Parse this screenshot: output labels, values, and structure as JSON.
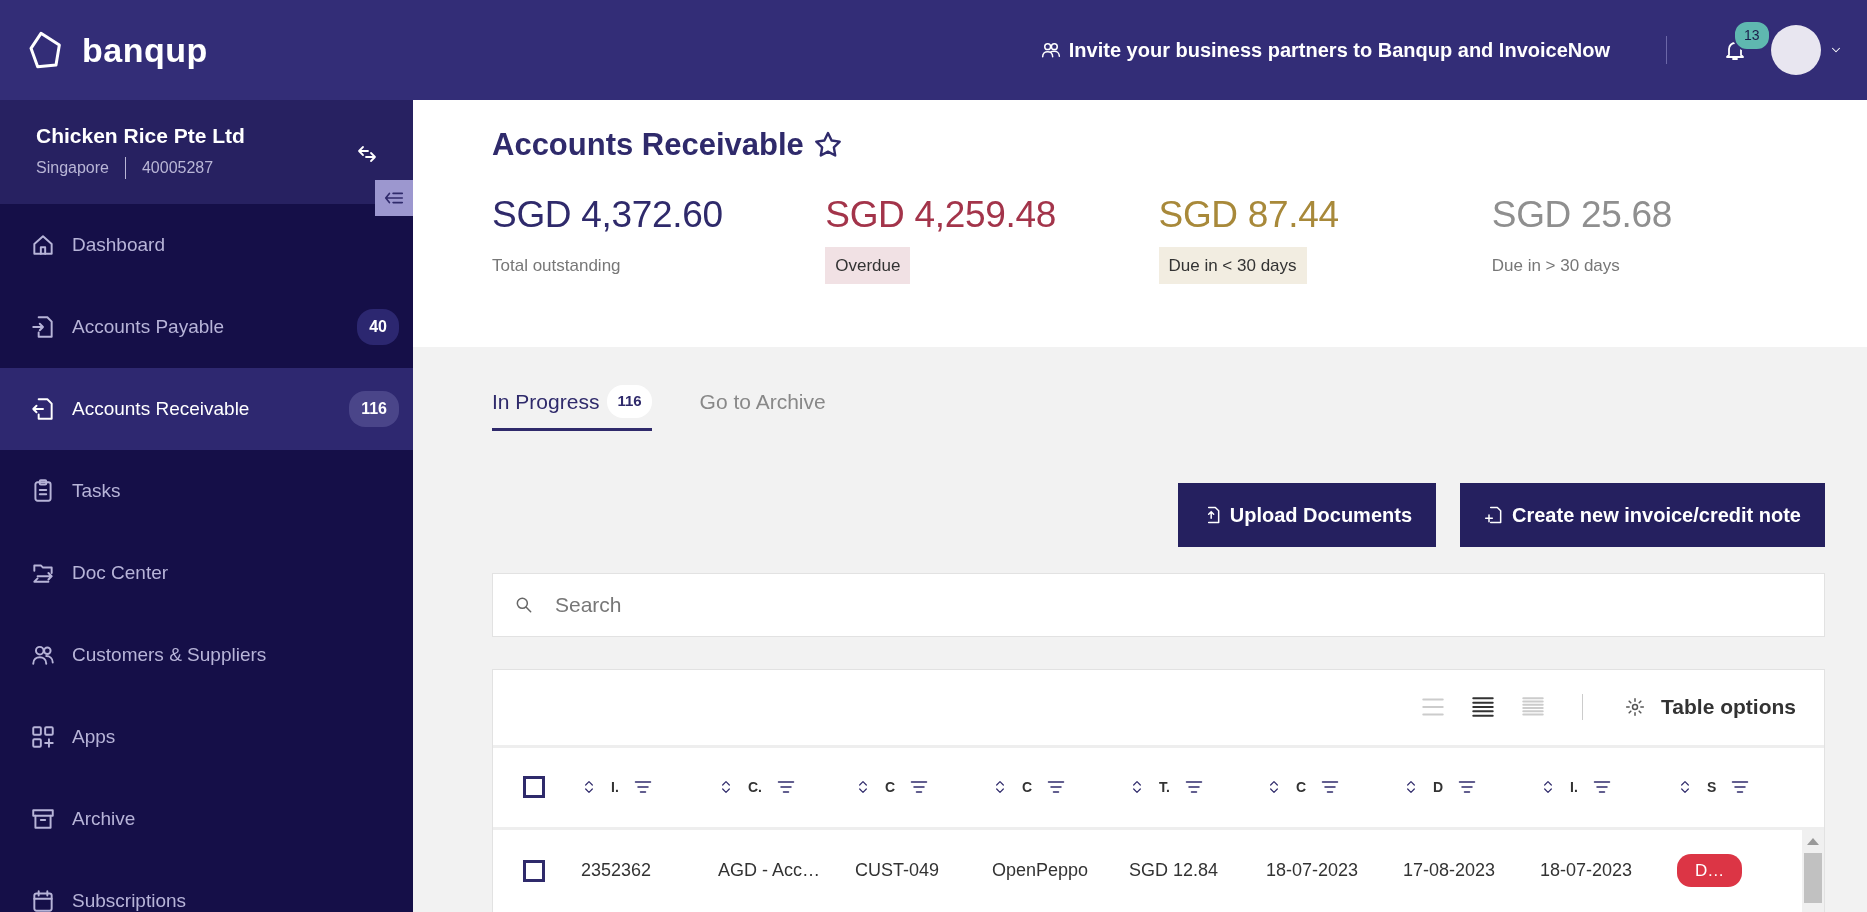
{
  "header": {
    "logo": "banqup",
    "invite": "Invite your business partners to Banqup and InvoiceNow",
    "notifications": "13"
  },
  "company": {
    "name": "Chicken Rice Pte Ltd",
    "country": "Singapore",
    "number": "40005287"
  },
  "sidebar": {
    "items": [
      {
        "label": "Dashboard",
        "selected": false
      },
      {
        "label": "Accounts Payable",
        "selected": false,
        "count": "40"
      },
      {
        "label": "Accounts Receivable",
        "selected": true,
        "count": "116"
      },
      {
        "label": "Tasks",
        "selected": false
      },
      {
        "label": "Doc Center",
        "selected": false
      },
      {
        "label": "Customers & Suppliers",
        "selected": false
      },
      {
        "label": "Apps",
        "selected": false
      },
      {
        "label": "Archive",
        "selected": false
      },
      {
        "label": "Subscriptions",
        "selected": false
      }
    ]
  },
  "page": {
    "title": "Accounts Receivable",
    "favorite": false
  },
  "stats": [
    {
      "amount": "SGD 4,372.60",
      "label": "Total outstanding",
      "color": "#2f2a6b",
      "kind": "plain"
    },
    {
      "amount": "SGD 4,259.48",
      "label": "Overdue",
      "color": "#a3344a",
      "kind": "tag"
    },
    {
      "amount": "SGD 87.44",
      "label": "Due in < 30 days",
      "color": "#a8893a",
      "kind": "tag"
    },
    {
      "amount": "SGD 25.68",
      "label": "Due in > 30 days",
      "color": "#8f8f8f",
      "kind": "plain"
    }
  ],
  "tabs": [
    {
      "label": "In Progress",
      "count": "116",
      "selected": true
    },
    {
      "label": "Go to Archive",
      "selected": false
    }
  ],
  "buttons": [
    "Upload Documents",
    "Create new invoice/credit note"
  ],
  "search": {
    "placeholder": "Search"
  },
  "view_modes": [
    {
      "selected": false
    },
    {
      "selected": true
    },
    {
      "selected": false
    }
  ],
  "table_options": "Table options",
  "table": {
    "all_checked": false,
    "columns": [
      "I.",
      "C.",
      "C",
      "C",
      "T.",
      "C",
      "D",
      "I.",
      "S"
    ],
    "rows": [
      {
        "checked": false,
        "cells": [
          "2352362",
          "AGD - Acc…",
          "CUST-049",
          "OpenPeppo",
          "SGD 12.84",
          "18-07-2023",
          "17-08-2023",
          "18-07-2023"
        ],
        "status": {
          "text": "D…",
          "color": "#dc3545"
        }
      }
    ]
  }
}
